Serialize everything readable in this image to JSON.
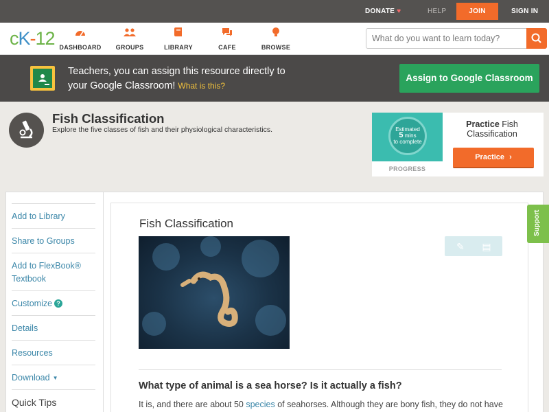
{
  "topbar": {
    "donate": "DONATE",
    "help": "HELP",
    "join": "JOIN",
    "signin": "SIGN IN"
  },
  "nav": {
    "logo_parts": [
      "c",
      "K",
      "-",
      "12"
    ],
    "items": [
      {
        "label": "DASHBOARD",
        "icon": "dashboard-icon"
      },
      {
        "label": "GROUPS",
        "icon": "groups-icon"
      },
      {
        "label": "LIBRARY",
        "icon": "library-icon"
      },
      {
        "label": "CAFE",
        "icon": "cafe-icon"
      },
      {
        "label": "BROWSE",
        "icon": "browse-icon"
      }
    ],
    "search_placeholder": "What do you want to learn today?"
  },
  "banner": {
    "line1": "Teachers, you can assign this resource directly to",
    "line2": "your Google Classroom!",
    "what": "What is this?",
    "assign_label": "Assign to Google Classroom"
  },
  "concept": {
    "title": "Fish Classification",
    "description": "Explore the five classes of fish and their physiological characteristics."
  },
  "practice": {
    "estimated": "Estimated",
    "mins": "5",
    "mins_label": "mins",
    "to_complete": "to complete",
    "progress_label": "PROGRESS",
    "practice_bold": "Practice",
    "practice_rest": " Fish Classification",
    "button_label": "Practice"
  },
  "sidebar": {
    "items": [
      {
        "label": "Add to Library"
      },
      {
        "label": "Share to Groups"
      },
      {
        "label": "Add to FlexBook®"
      },
      {
        "label": "Textbook"
      },
      {
        "label": "Customize"
      },
      {
        "label": "Details"
      },
      {
        "label": "Resources"
      },
      {
        "label": "Download"
      },
      {
        "label": "Quick Tips"
      }
    ]
  },
  "article": {
    "title": "Fish Classification",
    "question": "What type of animal is a sea horse? Is it actually a fish?",
    "body_pre": "It is, and there are about 50 ",
    "body_link": "species",
    "body_post": " of seahorses. Although they are bony fish, they do not have"
  },
  "support": {
    "label": "Support"
  },
  "colors": {
    "accent_orange": "#f26b2a",
    "google_green": "#2aa35c",
    "link_blue": "#3a86a8",
    "support_green": "#7dc04b"
  }
}
